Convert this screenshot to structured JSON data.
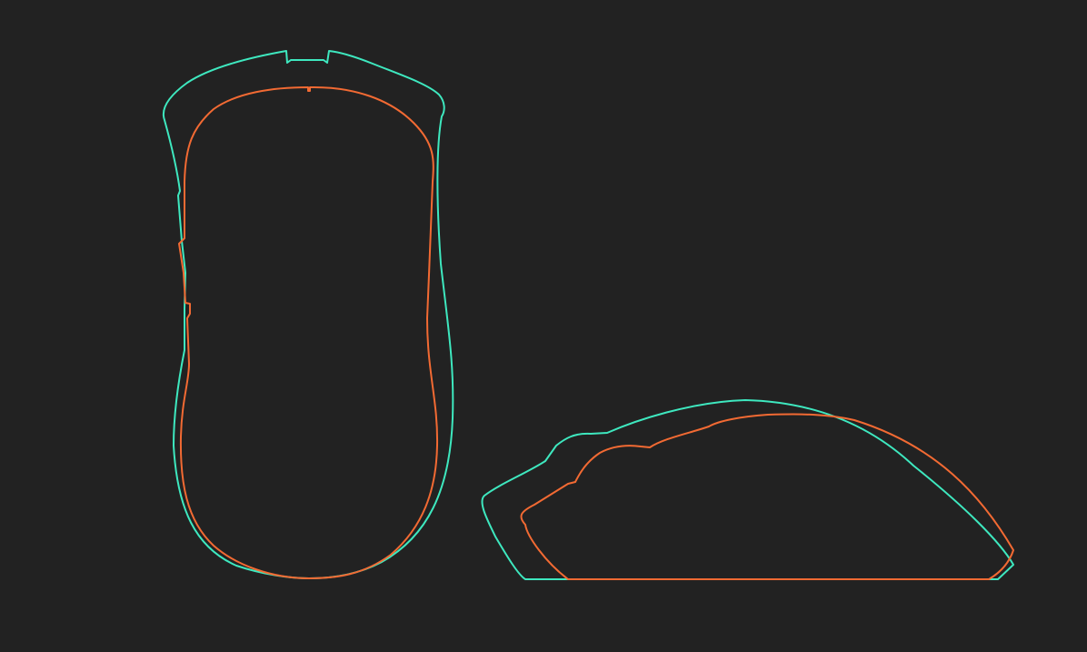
{
  "background_color": "#222222",
  "shapes": {
    "mouse_a": {
      "color": "#3ee8bf",
      "views": [
        "top-view",
        "side-view"
      ]
    },
    "mouse_b": {
      "color": "#f26a33",
      "views": [
        "top-view",
        "side-view"
      ]
    }
  }
}
